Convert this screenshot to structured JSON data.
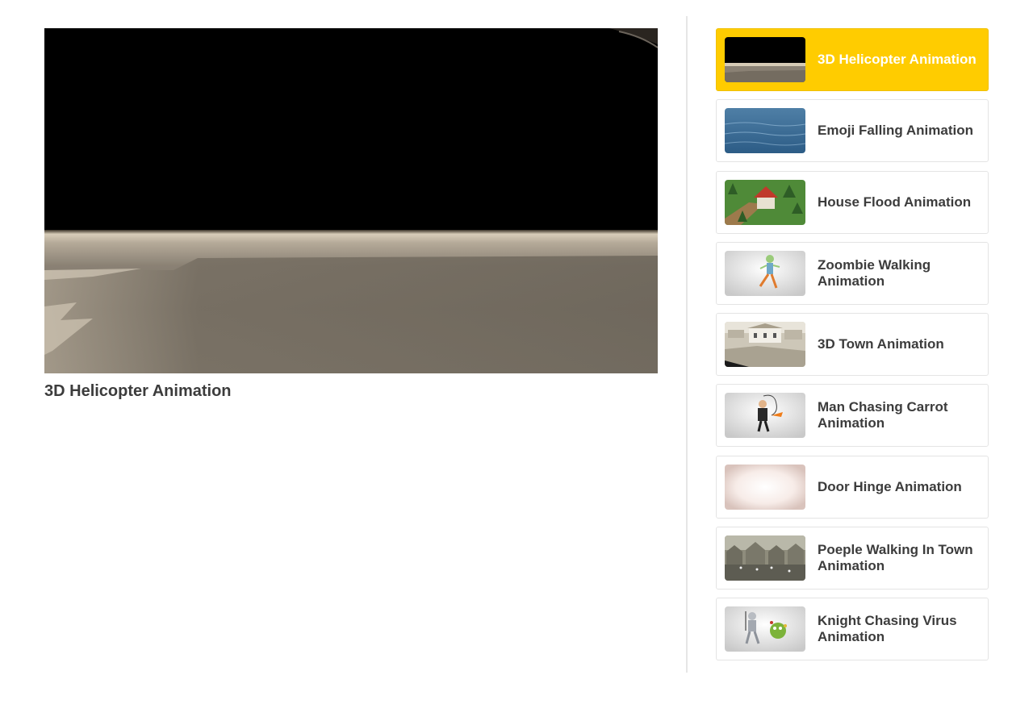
{
  "player": {
    "title": "3D Helicopter Animation"
  },
  "playlist": {
    "active_index": 0,
    "accent_color": "#ffcc00",
    "items": [
      {
        "label": "3D Helicopter Animation",
        "thumb": "helicopter-scene-thumbnail"
      },
      {
        "label": "Emoji Falling Animation",
        "thumb": "blue-water-surface-thumbnail"
      },
      {
        "label": "House Flood Animation",
        "thumb": "house-in-forest-thumbnail"
      },
      {
        "label": "Zoombie Walking Animation",
        "thumb": "zombie-running-thumbnail"
      },
      {
        "label": "3D Town Animation",
        "thumb": "town-buildings-thumbnail"
      },
      {
        "label": "Man Chasing Carrot Animation",
        "thumb": "man-with-carrot-thumbnail"
      },
      {
        "label": "Door Hinge Animation",
        "thumb": "bright-light-thumbnail"
      },
      {
        "label": "Poeple Walking In Town Animation",
        "thumb": "people-in-town-thumbnail"
      },
      {
        "label": "Knight Chasing Virus Animation",
        "thumb": "knight-and-virus-thumbnail"
      }
    ]
  }
}
